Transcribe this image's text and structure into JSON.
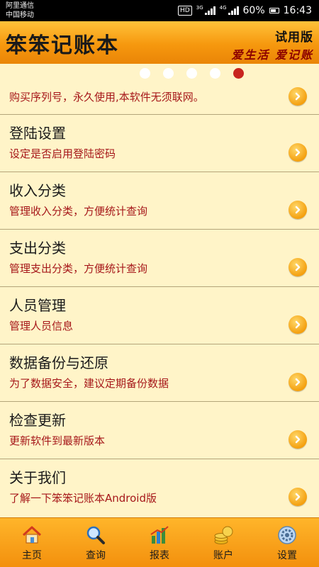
{
  "status": {
    "carrier1": "阿里通信",
    "carrier2": "中国移动",
    "hd": "HD",
    "net1": "3G",
    "net2": "4G",
    "battery": "60%",
    "time": "16:43"
  },
  "header": {
    "title": "笨笨记账本",
    "trial": "试用版",
    "slogan": "爱生活 爱记账"
  },
  "carousel": {
    "count": 5,
    "active_index": 4
  },
  "menu": [
    {
      "subtitle": "购买序列号，永久使用,本软件无须联网。"
    },
    {
      "title": "登陆设置",
      "subtitle": "设定是否启用登陆密码"
    },
    {
      "title": "收入分类",
      "subtitle": "管理收入分类，方便统计查询"
    },
    {
      "title": "支出分类",
      "subtitle": "管理支出分类，方便统计查询"
    },
    {
      "title": "人员管理",
      "subtitle": "管理人员信息"
    },
    {
      "title": "数据备份与还原",
      "subtitle": "为了数据安全，建议定期备份数据"
    },
    {
      "title": "检查更新",
      "subtitle": "更新软件到最新版本"
    },
    {
      "title": "关于我们",
      "subtitle": "了解一下笨笨记账本Android版"
    }
  ],
  "tabs": [
    {
      "label": "主页",
      "icon": "home-icon"
    },
    {
      "label": "查询",
      "icon": "search-icon"
    },
    {
      "label": "报表",
      "icon": "chart-icon"
    },
    {
      "label": "账户",
      "icon": "coins-icon"
    },
    {
      "label": "设置",
      "icon": "settings-icon"
    }
  ],
  "colors": {
    "accent": "#f6980e",
    "subtitle": "#a6181a",
    "background": "#fff4c8",
    "active_dot": "#c8241e"
  }
}
